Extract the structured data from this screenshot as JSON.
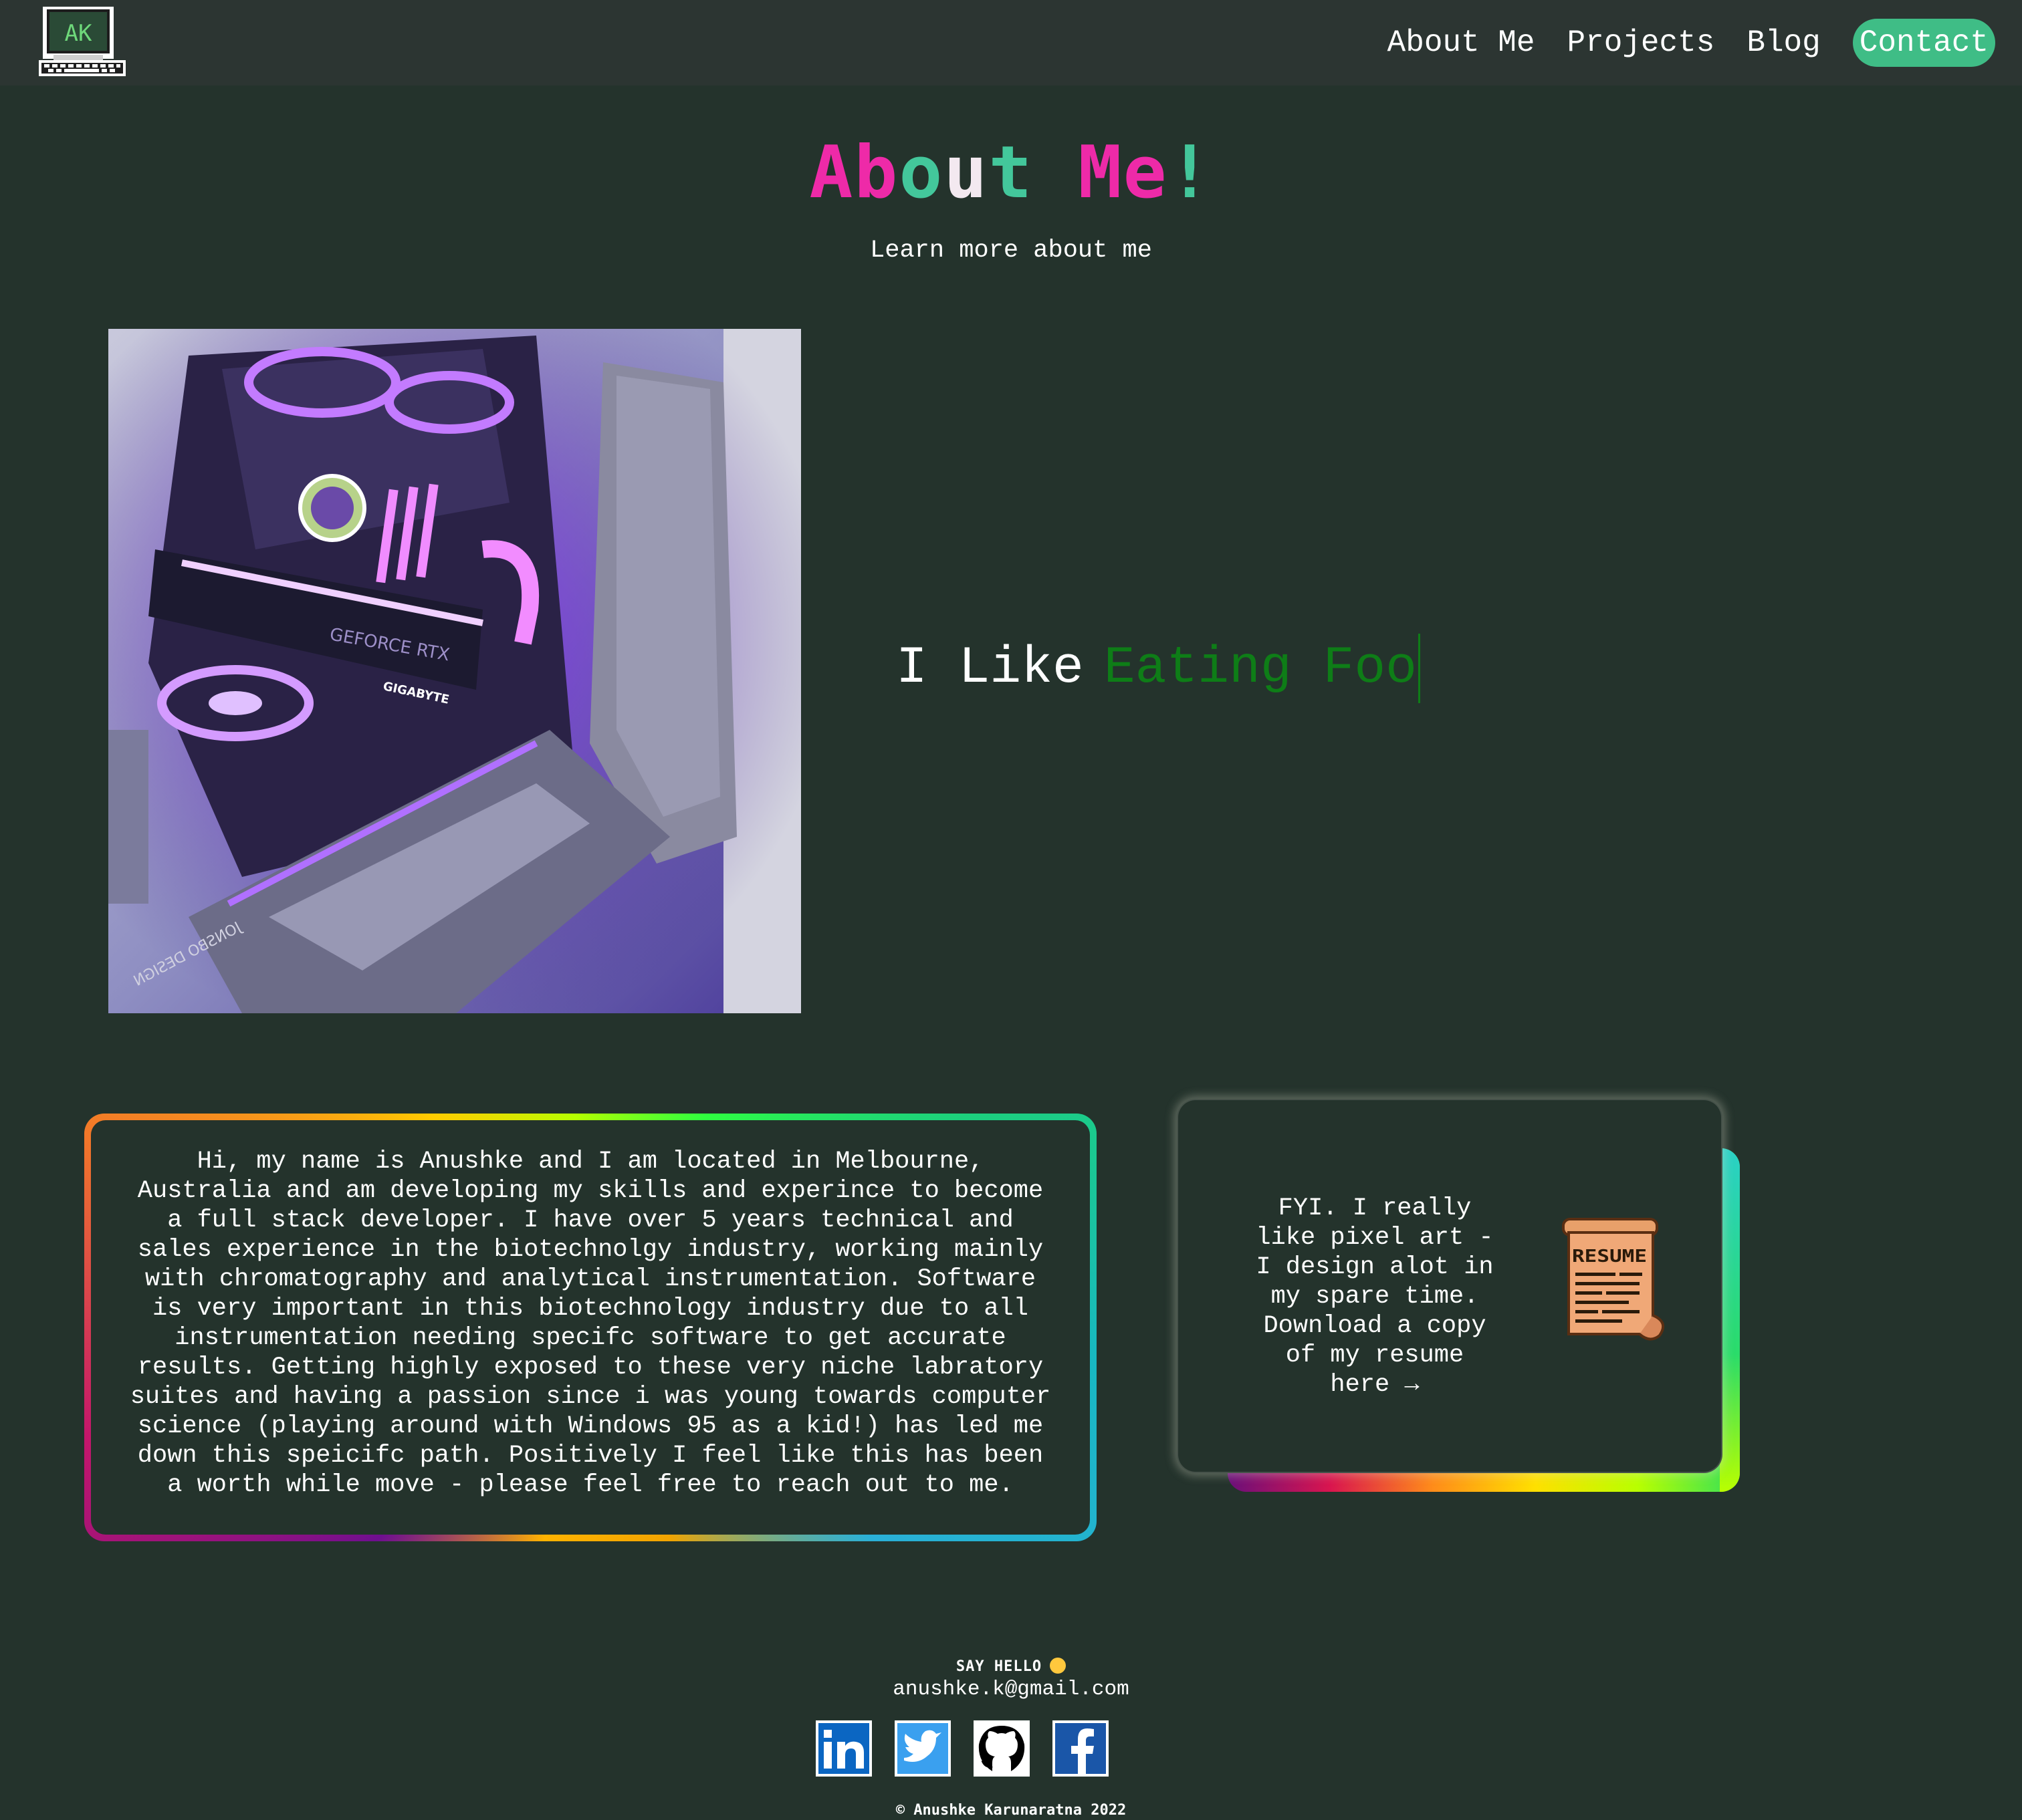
{
  "nav": {
    "logo_text": "AK",
    "links": [
      "About Me",
      "Projects",
      "Blog"
    ],
    "contact": "Contact"
  },
  "hero": {
    "title": "About Me!",
    "subtitle": "Learn more about me"
  },
  "typing": {
    "static": "I Like",
    "dynamic": "Eating Foo"
  },
  "bio": "Hi, my name is Anushke and I am located in Melbourne,\nAustralia and am developing my skills and experince to become\na full stack developer. I have over 5 years technical and\nsales experience in the biotechnolgy industry, working mainly\nwith chromatography and analytical instrumentation. Software\nis very important in this biotechnology industry due to all\ninstrumentation needing specifc software to get accurate\nresults. Getting highly exposed to these very niche labratory\nsuites and having a passion since i was young towards computer\nscience (playing around with Windows 95 as a kid!) has led me\ndown this speicifc path. Positively I feel like this has been\na worth while move - please feel free to reach out to me.",
  "resume": {
    "text": "FYI. I really\nlike pixel art -\nI design alot in\nmy spare time.\nDownload a copy\nof my resume\nhere →",
    "icon_label": "RESUME"
  },
  "photo": {
    "labels": [
      "GEFORCE RTX",
      "GIGABYTE",
      "JONSBO DESIGN"
    ]
  },
  "footer": {
    "say_hello": "SAY HELLO",
    "email": "anushke.k@gmail.com",
    "copyright": "© Anushke Karunaratna 2022"
  },
  "colors": {
    "background": "#24332c",
    "navbar": "#2c3532",
    "contact_button": "#3fbd86",
    "typing_accent": "#0e7d17",
    "title_pink": "#ee2aa8",
    "title_green": "#43c79b"
  },
  "icons": [
    "ak-computer-logo-icon",
    "resume-scroll-icon",
    "linkedin-icon",
    "twitter-icon",
    "github-icon",
    "facebook-icon"
  ]
}
